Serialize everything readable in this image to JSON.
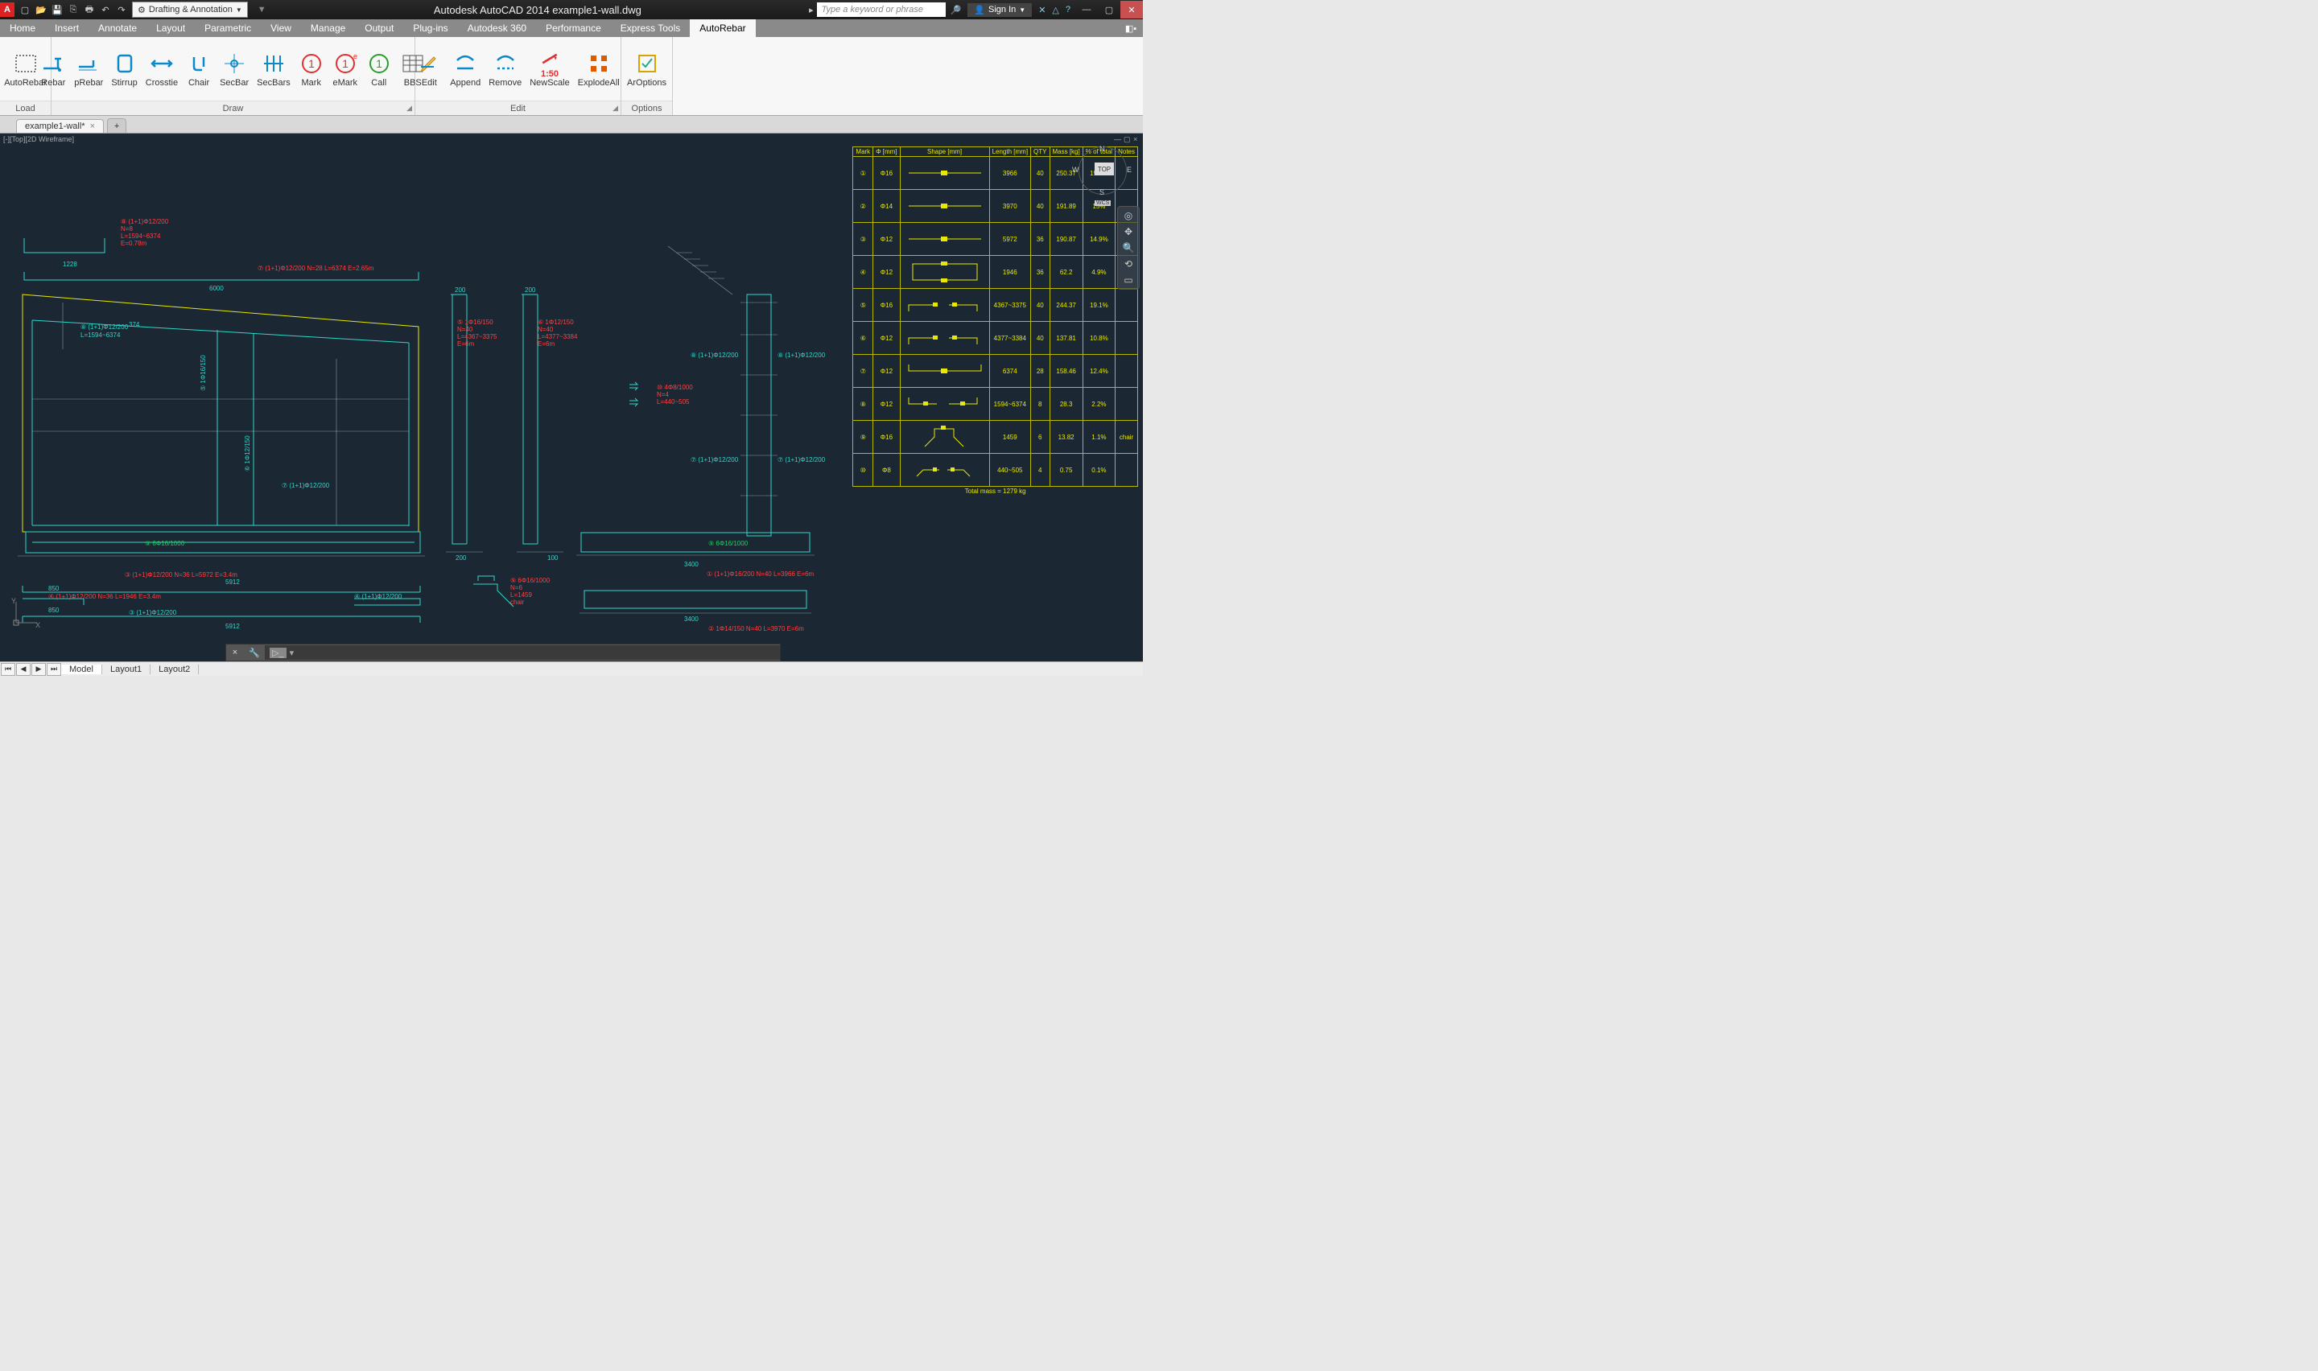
{
  "title": "Autodesk AutoCAD 2014    example1-wall.dwg",
  "workspace": "Drafting & Annotation",
  "search_placeholder": "Type a keyword or phrase",
  "signin": "Sign In",
  "qat": [
    "new",
    "open",
    "save",
    "saveall",
    "print",
    "undo",
    "redo"
  ],
  "menu_tabs": [
    "Home",
    "Insert",
    "Annotate",
    "Layout",
    "Parametric",
    "View",
    "Manage",
    "Output",
    "Plug-ins",
    "Autodesk 360",
    "Performance",
    "Express Tools",
    "AutoRebar"
  ],
  "active_tab": "AutoRebar",
  "ribbon": {
    "panels": [
      {
        "title": "Load",
        "items": [
          {
            "label": "AutoRebar",
            "icon": "grid"
          }
        ]
      },
      {
        "title": "Draw",
        "items": [
          {
            "label": "Rebar",
            "icon": "rebar"
          },
          {
            "label": "pRebar",
            "icon": "prebar"
          },
          {
            "label": "Stirrup",
            "icon": "stirrup"
          },
          {
            "label": "Crosstie",
            "icon": "crosstie"
          },
          {
            "label": "Chair",
            "icon": "chair"
          },
          {
            "label": "SecBar",
            "icon": "secbar"
          },
          {
            "label": "SecBars",
            "icon": "secbars"
          },
          {
            "label": "Mark",
            "icon": "mark"
          },
          {
            "label": "eMark",
            "icon": "emark"
          },
          {
            "label": "Call",
            "icon": "call"
          },
          {
            "label": "BBS",
            "icon": "bbs"
          }
        ]
      },
      {
        "title": "Edit",
        "items": [
          {
            "label": "Edit",
            "icon": "edit"
          },
          {
            "label": "Append",
            "icon": "append"
          },
          {
            "label": "Remove",
            "icon": "remove"
          },
          {
            "label": "NewScale",
            "icon": "newscale"
          },
          {
            "label": "ExplodeAll",
            "icon": "explode"
          }
        ]
      },
      {
        "title": "Options",
        "items": [
          {
            "label": "ArOptions",
            "icon": "options"
          }
        ]
      }
    ],
    "newscale_text": "1:50"
  },
  "file_tab": "example1-wall*",
  "view_label": "[-][Top][2D Wireframe]",
  "viewcube": {
    "face": "TOP",
    "N": "N",
    "S": "S",
    "E": "E",
    "W": "W",
    "wcs": "WCS"
  },
  "layout_tabs": [
    "Model",
    "Layout1",
    "Layout2"
  ],
  "active_layout": "Model",
  "annotations": {
    "a1": "⑧ (1+1)Φ12/200",
    "a1b": "N=8",
    "a1c": "L=1594~6374",
    "a1d": "E=0.78m",
    "a2": "⑦ (1+1)Φ12/200  N=28  L=6374  E=2.65m",
    "a3": "⑧ (1+1)Φ12/200",
    "a3b": "L=1594~6374",
    "a4": "⑤ 1Φ16/150",
    "a4b": "N=40",
    "a4c": "L=4367~3375",
    "a4d": "E=6m",
    "a5": "⑥ 1Φ12/150",
    "a5b": "N=40",
    "a5c": "L=4377~3384",
    "a5d": "E=6m",
    "a6": "⑩ 4Φ8/1000",
    "a6b": "N=4",
    "a6c": "L=440~505",
    "a7": "⑧ (1+1)Φ12/200",
    "a8": "⑧ (1+1)Φ12/200",
    "a9": "⑦ (1+1)Φ12/200",
    "a10": "⑦ (1+1)Φ12/200",
    "a11": "⑨ 6Φ16/1000",
    "a12": "⑨ 6Φ16/1000",
    "a13": "① (1+1)Φ16/200  N=40  L=3966  E=6m",
    "a14": "⑤ 1Φ16/150",
    "a15": "⑥ 1Φ12/150",
    "a16": "⑦ (1+1)Φ12/200",
    "a17": "③ (1+1)Φ12/200  N=36  L=5972  E=3.4m",
    "a18": "④ (1+1)Φ12/200  N=36  L=1946  E=3.4m",
    "a19": "③ (1+1)Φ12/200",
    "a20": "④ (1+1)Φ12/200",
    "a21": "⑨ 6Φ16/1000",
    "a21b": "N=6",
    "a21c": "L=1459",
    "a21d": "chair",
    "a22": "② 1Φ14/150  N=40  L=3970  E=6m",
    "dim1": "1228",
    "dim2": "6000",
    "dim3": "374",
    "dim4": "200",
    "dim5": "200",
    "dim6": "3400",
    "dim7": "5912",
    "dim8": "850",
    "dim9": "5912",
    "dim10": "850",
    "dim11": "200",
    "dim12": "200",
    "dim13": "3400",
    "dim14": "100"
  },
  "schedule": {
    "headers": [
      "Mark",
      "Φ [mm]",
      "Shape [mm]",
      "Length [mm]",
      "QTY",
      "Mass [kg]",
      "% of total",
      "Notes"
    ],
    "rows": [
      {
        "mark": "①",
        "dia": "Φ16",
        "len": "3966",
        "qty": "40",
        "mass": "250.37",
        "pct": "19.6%",
        "notes": ""
      },
      {
        "mark": "②",
        "dia": "Φ14",
        "len": "3970",
        "qty": "40",
        "mass": "191.89",
        "pct": "15%",
        "notes": ""
      },
      {
        "mark": "③",
        "dia": "Φ12",
        "len": "5972",
        "qty": "36",
        "mass": "190.87",
        "pct": "14.9%",
        "notes": ""
      },
      {
        "mark": "④",
        "dia": "Φ12",
        "len": "1946",
        "qty": "36",
        "mass": "62.2",
        "pct": "4.9%",
        "notes": ""
      },
      {
        "mark": "⑤",
        "dia": "Φ16",
        "len": "4367~3375",
        "qty": "40",
        "mass": "244.37",
        "pct": "19.1%",
        "notes": ""
      },
      {
        "mark": "⑥",
        "dia": "Φ12",
        "len": "4377~3384",
        "qty": "40",
        "mass": "137.81",
        "pct": "10.8%",
        "notes": ""
      },
      {
        "mark": "⑦",
        "dia": "Φ12",
        "len": "6374",
        "qty": "28",
        "mass": "158.46",
        "pct": "12.4%",
        "notes": ""
      },
      {
        "mark": "⑧",
        "dia": "Φ12",
        "len": "1594~6374",
        "qty": "8",
        "mass": "28.3",
        "pct": "2.2%",
        "notes": ""
      },
      {
        "mark": "⑨",
        "dia": "Φ16",
        "len": "1459",
        "qty": "6",
        "mass": "13.82",
        "pct": "1.1%",
        "notes": "chair"
      },
      {
        "mark": "⑩",
        "dia": "Φ8",
        "len": "440~505",
        "qty": "4",
        "mass": "0.75",
        "pct": "0.1%",
        "notes": ""
      }
    ],
    "total": "Total  mass  =  1279  kg"
  }
}
